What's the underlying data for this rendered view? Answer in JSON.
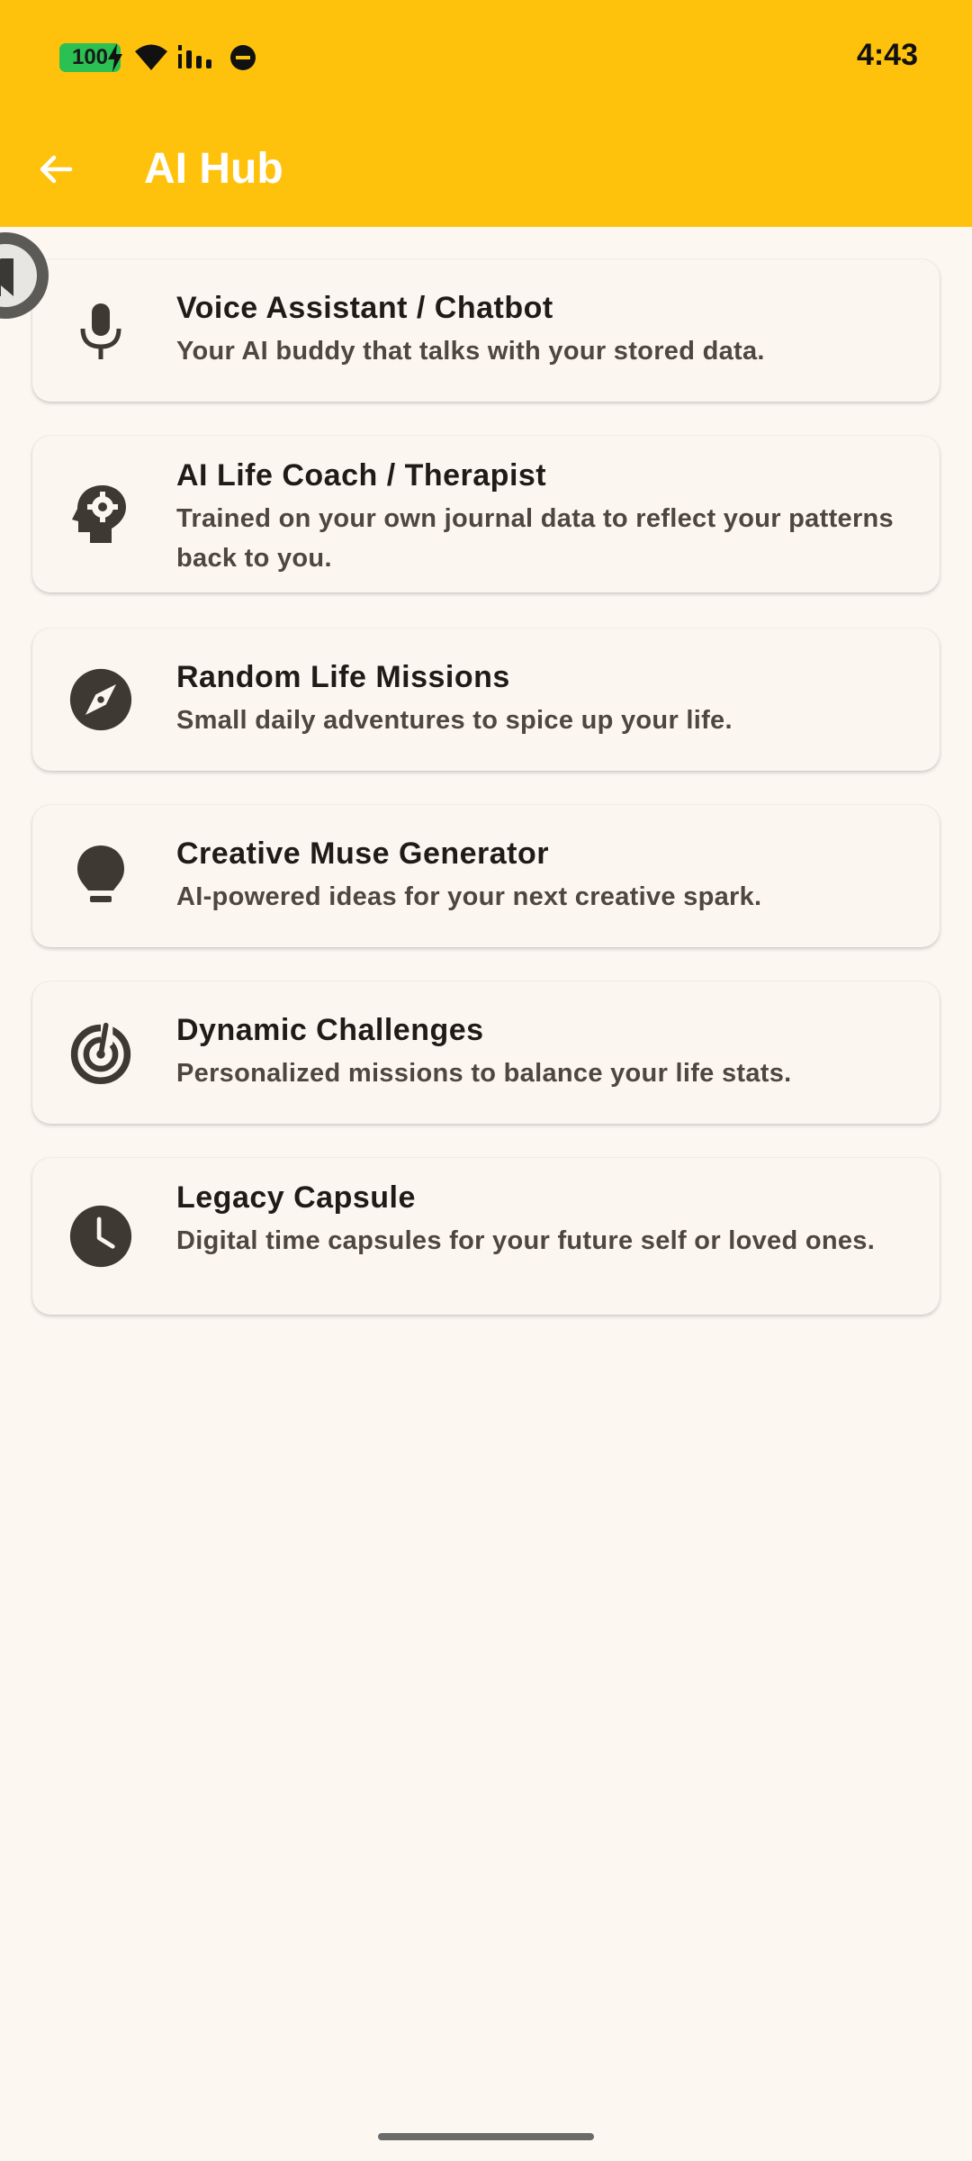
{
  "status_bar": {
    "battery": "100",
    "time": "4:43"
  },
  "app_bar": {
    "title": "AI Hub",
    "back_icon": "arrow-back-icon"
  },
  "items": [
    {
      "icon": "microphone-icon",
      "title": "Voice Assistant / Chatbot",
      "subtitle": "Your AI buddy that talks with your stored data."
    },
    {
      "icon": "psychology-head-gear-icon",
      "title": "AI Life Coach / Therapist",
      "subtitle": "Trained on your own journal data to reflect your patterns back to you."
    },
    {
      "icon": "compass-icon",
      "title": "Random Life Missions",
      "subtitle": "Small daily adventures to spice up your life."
    },
    {
      "icon": "lightbulb-icon",
      "title": "Creative Muse Generator",
      "subtitle": "AI-powered ideas for your next creative spark."
    },
    {
      "icon": "radar-target-icon",
      "title": "Dynamic Challenges",
      "subtitle": "Personalized missions to balance your life stats."
    },
    {
      "icon": "clock-icon",
      "title": "Legacy Capsule",
      "subtitle": "Digital time capsules for your future self or loved ones."
    }
  ],
  "colors": {
    "app_bar": "#FFC20C",
    "background": "#FDF7F2",
    "card": "#FCF6F1",
    "icon": "#3E3A33",
    "title_text": "#1F1B16",
    "subtitle_text": "#4E4640"
  }
}
